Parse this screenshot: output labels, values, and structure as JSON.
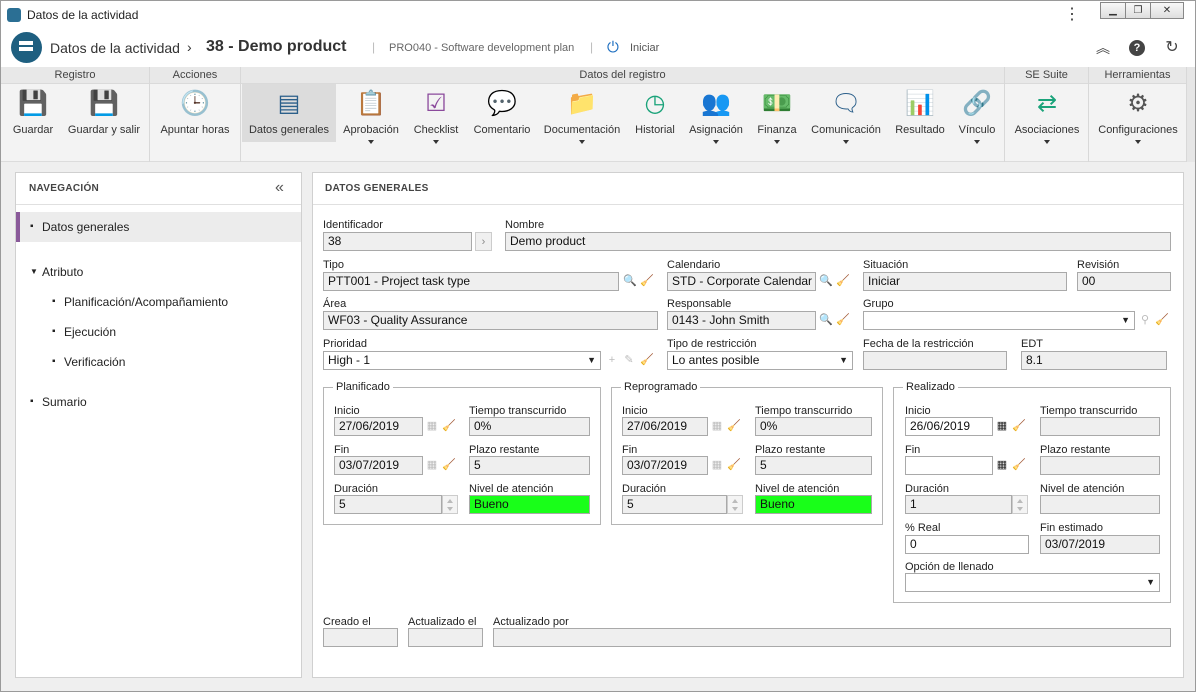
{
  "window": {
    "title": "Datos de la actividad"
  },
  "header": {
    "breadcrumb": "Datos de la actividad",
    "separator": "›",
    "record_title": "38 - Demo product",
    "plan": "PRO040 - Software development plan",
    "status_action": "Iniciar"
  },
  "ribbon": {
    "groups": [
      {
        "label": "Registro"
      },
      {
        "label": "Acciones"
      },
      {
        "label": "Datos del registro"
      },
      {
        "label": "SE Suite"
      },
      {
        "label": "Herramientas"
      }
    ],
    "buttons": [
      {
        "label": "Guardar",
        "icon": "save-icon",
        "color": "#8b4a9c"
      },
      {
        "label": "Guardar y salir",
        "icon": "save-exit-icon",
        "color": "#8b4a9c"
      },
      {
        "label": "Apuntar horas",
        "icon": "clock-icon",
        "color": "#555555"
      },
      {
        "label": "Datos generales",
        "icon": "form-icon",
        "color": "#2b5f8a"
      },
      {
        "label": "Aprobación",
        "icon": "approval-icon",
        "color": "#2e9e4e"
      },
      {
        "label": "Checklist",
        "icon": "checklist-icon",
        "color": "#8b4a9c"
      },
      {
        "label": "Comentario",
        "icon": "comment-icon",
        "color": "#2b5f8a"
      },
      {
        "label": "Documentación",
        "icon": "folder-icon",
        "color": "#7a7a7a"
      },
      {
        "label": "Historial",
        "icon": "history-icon",
        "color": "#1aa37a"
      },
      {
        "label": "Asignación",
        "icon": "users-icon",
        "color": "#2b5f8a"
      },
      {
        "label": "Finanza",
        "icon": "money-icon",
        "color": "#2e9e4e"
      },
      {
        "label": "Comunicación",
        "icon": "communication-icon",
        "color": "#2b5f8a"
      },
      {
        "label": "Resultado",
        "icon": "result-icon",
        "color": "#c07020"
      },
      {
        "label": "Vínculo",
        "icon": "link-icon",
        "color": "#1e6fc0"
      },
      {
        "label": "Asociaciones",
        "icon": "associations-icon",
        "color": "#1aa37a"
      },
      {
        "label": "Configuraciones",
        "icon": "gears-icon",
        "color": "#555555"
      }
    ]
  },
  "nav": {
    "heading": "NAVEGACIÓN",
    "items": [
      {
        "label": "Datos generales",
        "bullet": "▪"
      },
      {
        "label": "Atributo",
        "bullet": "▼"
      },
      {
        "label": "Planificación/Acompañamiento",
        "bullet": "▪"
      },
      {
        "label": "Ejecución",
        "bullet": "▪"
      },
      {
        "label": "Verificación",
        "bullet": "▪"
      },
      {
        "label": "Sumario",
        "bullet": "▪"
      }
    ]
  },
  "main": {
    "heading": "DATOS GENERALES"
  },
  "form": {
    "identificador": {
      "label": "Identificador",
      "value": "38"
    },
    "nombre": {
      "label": "Nombre",
      "value": "Demo product"
    },
    "tipo": {
      "label": "Tipo",
      "value": "PTT001 - Project task type"
    },
    "calendario": {
      "label": "Calendario",
      "value": "STD - Corporate Calendar"
    },
    "situacion": {
      "label": "Situación",
      "value": "Iniciar"
    },
    "revision": {
      "label": "Revisión",
      "value": "00"
    },
    "area": {
      "label": "Área",
      "value": "WF03 - Quality Assurance"
    },
    "responsable": {
      "label": "Responsable",
      "value": "0143 - John Smith"
    },
    "grupo": {
      "label": "Grupo",
      "value": ""
    },
    "prioridad": {
      "label": "Prioridad",
      "value": "High - 1"
    },
    "tipo_restriccion": {
      "label": "Tipo de restricción",
      "value": "Lo antes posible"
    },
    "fecha_restriccion": {
      "label": "Fecha de la restricción",
      "value": ""
    },
    "edt": {
      "label": "EDT",
      "value": "8.1"
    },
    "planificado": {
      "legend": "Planificado",
      "inicio_label": "Inicio",
      "inicio": "27/06/2019",
      "tiempo_label": "Tiempo transcurrido",
      "tiempo": "0%",
      "fin_label": "Fin",
      "fin": "03/07/2019",
      "plazo_label": "Plazo restante",
      "plazo": "5",
      "duracion_label": "Duración",
      "duracion": "5",
      "nivel_label": "Nivel de atención",
      "nivel": "Bueno"
    },
    "reprogramado": {
      "legend": "Reprogramado",
      "inicio_label": "Inicio",
      "inicio": "27/06/2019",
      "tiempo_label": "Tiempo transcurrido",
      "tiempo": "0%",
      "fin_label": "Fin",
      "fin": "03/07/2019",
      "plazo_label": "Plazo restante",
      "plazo": "5",
      "duracion_label": "Duración",
      "duracion": "5",
      "nivel_label": "Nivel de atención",
      "nivel": "Bueno"
    },
    "realizado": {
      "legend": "Realizado",
      "inicio_label": "Inicio",
      "inicio": "26/06/2019",
      "tiempo_label": "Tiempo transcurrido",
      "tiempo": "",
      "fin_label": "Fin",
      "fin": "",
      "plazo_label": "Plazo restante",
      "plazo": "",
      "duracion_label": "Duración",
      "duracion": "1",
      "nivel_label": "Nivel de atención",
      "nivel": "",
      "real_label": "% Real",
      "real": "0",
      "fin_estimado_label": "Fin estimado",
      "fin_estimado": "03/07/2019",
      "opcion_label": "Opción de llenado",
      "opcion": ""
    },
    "creado": {
      "label": "Creado el",
      "value": ""
    },
    "actualizado": {
      "label": "Actualizado el",
      "value": ""
    },
    "actualizado_por": {
      "label": "Actualizado por",
      "value": ""
    }
  },
  "colors": {
    "accent": "#8a5a9a",
    "attention_good": "#19ff19",
    "brand": "#1e5f80"
  }
}
